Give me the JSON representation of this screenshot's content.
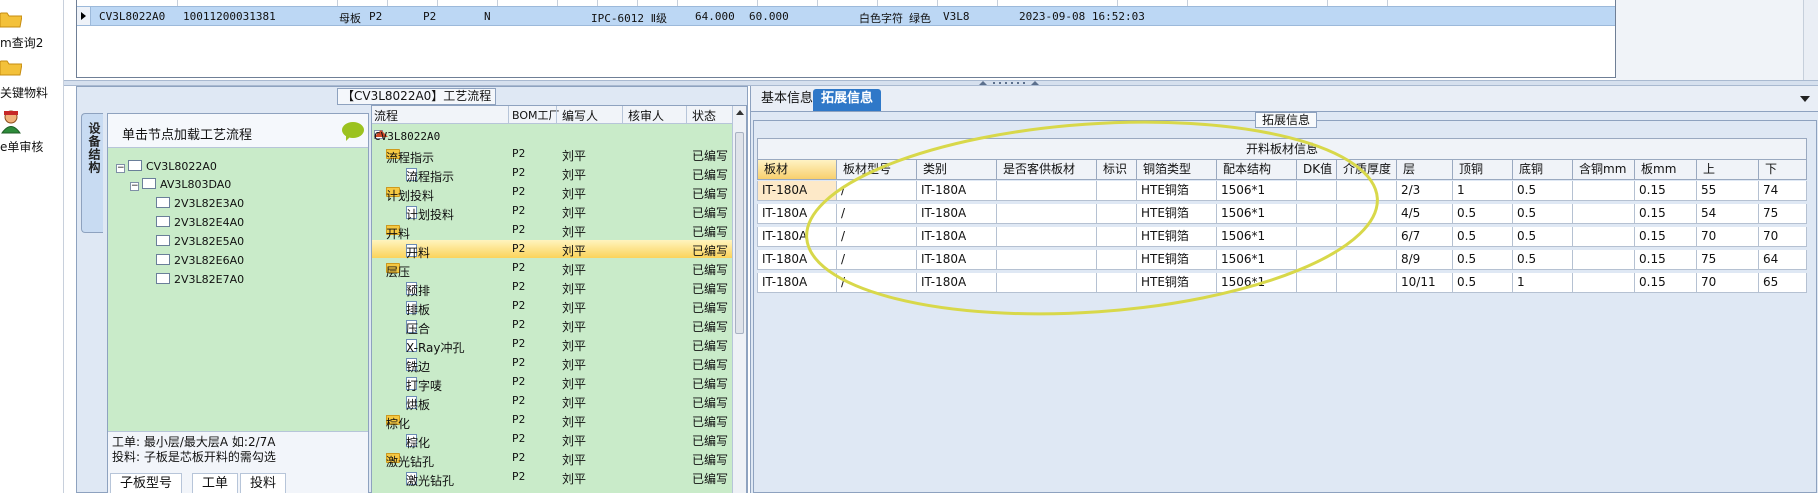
{
  "leftbar": {
    "items": [
      {
        "label": "m查询2",
        "icon": "folder-icon"
      },
      {
        "label": "关键物料",
        "icon": "folder-icon"
      },
      {
        "label": "e单审核",
        "icon": "user-icon"
      }
    ]
  },
  "top_grid": {
    "row": {
      "code": "CV3L8022A0",
      "number": "10011200031381",
      "board": "母板",
      "f1": "P2",
      "f2": "P2",
      "f3": "N",
      "standard": "IPC-6012 Ⅱ级",
      "v1": "64.000",
      "v2": "60.000",
      "char_color": "白色字符",
      "ink_color": "绿色",
      "ver": "V3L8",
      "time": "2023-09-08 16:52:03"
    }
  },
  "process": {
    "title": "【CV3L8022A0】工艺流程",
    "vtab_label": "设备结构",
    "struct_header": "单击节点加载工艺流程",
    "struct_nodes": [
      "CV3L8022A0",
      "AV3L803DA0",
      "2V3L82E3A0",
      "2V3L82E4A0",
      "2V3L82E5A0",
      "2V3L82E6A0",
      "2V3L82E7A0"
    ],
    "info_line1": "工单: 最小层/最大层A 如:2/7A",
    "info_line2": "投料: 子板是芯板开料的需勾选",
    "tabs": [
      "子板型号",
      "工单",
      "投料"
    ],
    "tree_columns": [
      "流程",
      "BOM工厂",
      "编写人",
      "核审人",
      "状态"
    ],
    "tree_root": "CV3L8022A0",
    "tree_rows": [
      {
        "name": "流程指示",
        "bom": "P2",
        "writer": "刘平",
        "status": "已编写",
        "kind": "folder"
      },
      {
        "name": "流程指示",
        "bom": "P2",
        "writer": "刘平",
        "status": "已编写",
        "kind": "doc"
      },
      {
        "name": "计划投料",
        "bom": "P2",
        "writer": "刘平",
        "status": "已编写",
        "kind": "folder"
      },
      {
        "name": "计划投料",
        "bom": "P2",
        "writer": "刘平",
        "status": "已编写",
        "kind": "doc"
      },
      {
        "name": "开料",
        "bom": "P2",
        "writer": "刘平",
        "status": "已编写",
        "kind": "folder"
      },
      {
        "name": "开料",
        "bom": "P2",
        "writer": "刘平",
        "status": "已编写",
        "kind": "doc"
      },
      {
        "name": "层压",
        "bom": "P2",
        "writer": "刘平",
        "status": "已编写",
        "kind": "folder"
      },
      {
        "name": "预排",
        "bom": "P2",
        "writer": "刘平",
        "status": "已编写",
        "kind": "doc"
      },
      {
        "name": "排板",
        "bom": "P2",
        "writer": "刘平",
        "status": "已编写",
        "kind": "doc"
      },
      {
        "name": "压合",
        "bom": "P2",
        "writer": "刘平",
        "status": "已编写",
        "kind": "doc"
      },
      {
        "name": "X-Ray冲孔",
        "bom": "P2",
        "writer": "刘平",
        "status": "已编写",
        "kind": "doc"
      },
      {
        "name": "铣边",
        "bom": "P2",
        "writer": "刘平",
        "status": "已编写",
        "kind": "doc"
      },
      {
        "name": "打字唛",
        "bom": "P2",
        "writer": "刘平",
        "status": "已编写",
        "kind": "doc"
      },
      {
        "name": "烘板",
        "bom": "P2",
        "writer": "刘平",
        "status": "已编写",
        "kind": "doc"
      },
      {
        "name": "棕化",
        "bom": "P2",
        "writer": "刘平",
        "status": "已编写",
        "kind": "folder"
      },
      {
        "name": "棕化",
        "bom": "P2",
        "writer": "刘平",
        "status": "已编写",
        "kind": "doc"
      },
      {
        "name": "激光钻孔",
        "bom": "P2",
        "writer": "刘平",
        "status": "已编写",
        "kind": "folder"
      },
      {
        "name": "激光钻孔",
        "bom": "P2",
        "writer": "刘平",
        "status": "已编写",
        "kind": "doc"
      }
    ]
  },
  "info": {
    "tabs": [
      "基本信息",
      "拓展信息"
    ],
    "ext_label": "拓展信息",
    "table_caption": "开料板材信息",
    "columns": [
      "板材",
      "板材型号",
      "类别",
      "是否客供板材",
      "标识",
      "铜箔类型",
      "配本结构",
      "DK值",
      "介质厚度",
      "层",
      "顶铜",
      "底铜",
      "含铜mm",
      "板mm",
      "上",
      "下"
    ],
    "rows": [
      [
        "IT-180A",
        "/",
        "IT-180A",
        "",
        "",
        "HTE铜箔",
        "1506*1",
        "",
        "",
        "2/3",
        "1",
        "0.5",
        "",
        "0.15",
        "55",
        "74"
      ],
      [
        "IT-180A",
        "/",
        "IT-180A",
        "",
        "",
        "HTE铜箔",
        "1506*1",
        "",
        "",
        "4/5",
        "0.5",
        "0.5",
        "",
        "0.15",
        "54",
        "75"
      ],
      [
        "IT-180A",
        "/",
        "IT-180A",
        "",
        "",
        "HTE铜箔",
        "1506*1",
        "",
        "",
        "6/7",
        "0.5",
        "0.5",
        "",
        "0.15",
        "70",
        "70"
      ],
      [
        "IT-180A",
        "/",
        "IT-180A",
        "",
        "",
        "HTE铜箔",
        "1506*1",
        "",
        "",
        "8/9",
        "0.5",
        "0.5",
        "",
        "0.15",
        "75",
        "64"
      ],
      [
        "IT-180A",
        "/",
        "IT-180A",
        "",
        "",
        "HTE铜箔",
        "1506*1",
        "",
        "",
        "10/11",
        "0.5",
        "1",
        "",
        "0.15",
        "70",
        "65"
      ]
    ]
  },
  "colors": {
    "selected_row": "#bcd7f4",
    "tree_bg": "#c9ebc9",
    "tab_active": "#2f78c8",
    "highlight_ellipse": "#d8d84a"
  }
}
